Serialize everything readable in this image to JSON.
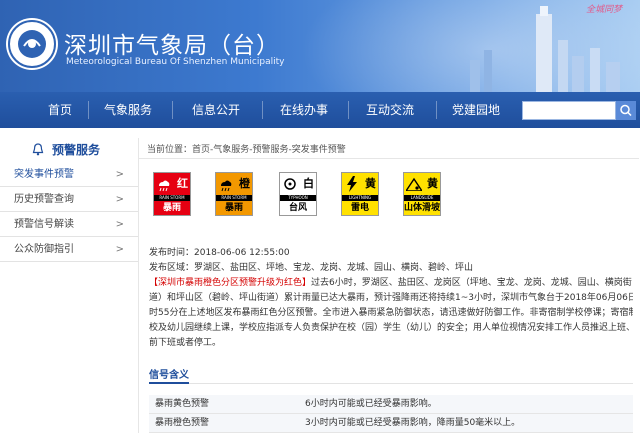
{
  "header": {
    "title": "深圳市气象局（台）",
    "subtitle": "Meteorological Bureau Of Shenzhen Municipality",
    "brand": "全城同梦"
  },
  "nav": {
    "items": [
      {
        "label": "首页"
      },
      {
        "label": "气象服务"
      },
      {
        "label": "信息公开"
      },
      {
        "label": "在线办事"
      },
      {
        "label": "互动交流"
      },
      {
        "label": "党建园地"
      }
    ]
  },
  "sidebar": {
    "title": "预警服务",
    "items": [
      {
        "label": "突发事件预警",
        "arrow": ">"
      },
      {
        "label": "历史预警查询",
        "arrow": ">"
      },
      {
        "label": "预警信号解读",
        "arrow": ">"
      },
      {
        "label": "公众防御指引",
        "arrow": ">"
      }
    ]
  },
  "breadcrumb": "当前位置：首页-气象服务-预警服务-突发事件预警",
  "signals": [
    {
      "char": "红",
      "band": "RAIN STORM",
      "name": "暴雨",
      "bg": "#e60012",
      "fg": "#ffffff"
    },
    {
      "char": "橙",
      "band": "RAIN STORM",
      "name": "暴雨",
      "bg": "#f39800",
      "fg": "#000000"
    },
    {
      "char": "白",
      "band": "TYPHOON",
      "name": "台风",
      "bg": "#ffffff",
      "fg": "#000000"
    },
    {
      "char": "黄",
      "band": "LIGHTNING",
      "name": "雷电",
      "bg": "#ffe100",
      "fg": "#000000"
    },
    {
      "char": "黄",
      "band": "LANDSLIDE",
      "name": "山体滑坡",
      "bg": "#ffe100",
      "fg": "#000000"
    }
  ],
  "info": {
    "publish_time": "发布时间：2018-06-06 12:55:00",
    "publish_area": "发布区域：罗湖区、盐田区、坪地、宝龙、龙岗、龙城、园山、横岗、碧岭、坪山",
    "headline": "【深圳市暴雨橙色分区预警升级为红色】",
    "body_1": "过去6小时，罗湖区、盐田区、龙岗区（坪地、宝龙、龙岗、龙城、园山、横岗街",
    "body_2": "道）和坪山区（碧岭、坪山街道）累计雨量已达大暴雨，预计强降雨还将持续1~3小时，深圳市气象台于2018年06月06日12",
    "body_3": "时55分在上述地区发布暴雨红色分区预警。全市进入暴雨紧急防御状态，请迅速做好防御工作。非寄宿制学校停课；寄宿制学",
    "body_4": "校及幼儿园继续上课，学校应指派专人负责保护在校（园）学生（幼儿）的安全；用人单位视情况安排工作人员推迟上班、提",
    "body_5": "前下班或者停工。"
  },
  "meaning": {
    "title": "信号含义",
    "rows": [
      {
        "name": "暴雨黄色预警",
        "desc": "6小时内可能或已经受暴雨影响。"
      },
      {
        "name": "暴雨橙色预警",
        "desc": "3小时内可能或已经受暴雨影响，降雨量50毫米以上。"
      }
    ]
  },
  "colors": {
    "nav_bg": "#1f4e9c",
    "accent": "#1f4e9c",
    "alert_red": "#d40000"
  }
}
